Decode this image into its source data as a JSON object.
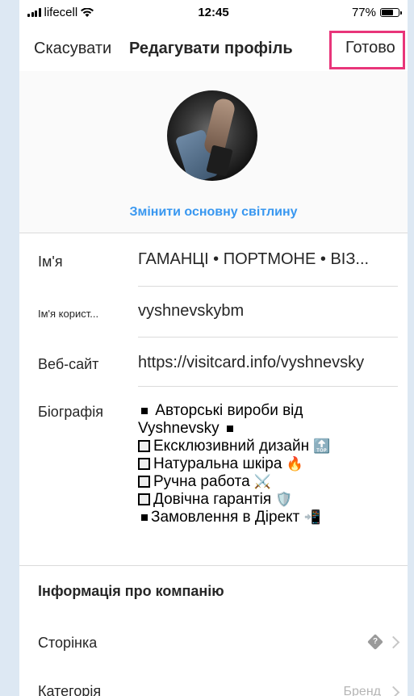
{
  "status": {
    "carrier": "lifecell",
    "time": "12:45",
    "battery": "77%",
    "battery_level": 0.77
  },
  "nav": {
    "cancel": "Скасувати",
    "title": "Редагувати профіль",
    "done": "Готово"
  },
  "photo": {
    "change_label": "Змінити основну світлину"
  },
  "fields": {
    "name": {
      "label": "Ім'я",
      "value": "ГАМАНЦІ • ПОРТМОНЕ • ВІЗ..."
    },
    "username": {
      "label": "Ім'я корист...",
      "value": "vyshnevskybm"
    },
    "website": {
      "label": "Веб-сайт",
      "value": "https://visitcard.info/vyshnevsky"
    },
    "bio": {
      "label": "Біографія",
      "line1": "Авторські вироби від",
      "line2": "Vyshnevsky",
      "line3": "Ексклюзивний дизайн",
      "line3_emoji": "🔝",
      "line4": "Натуральна шкіра",
      "line4_emoji": "🔥",
      "line5": "Ручна работа",
      "line5_emoji": "⚔️",
      "line6": "Довічна гарантія",
      "line6_emoji": "🛡️",
      "line7": "Замовлення в Дірект",
      "line7_emoji": "📲"
    }
  },
  "company": {
    "heading": "Інформація про компанію",
    "page_label": "Сторінка",
    "category_label": "Категорія",
    "category_value": "Бренд"
  }
}
